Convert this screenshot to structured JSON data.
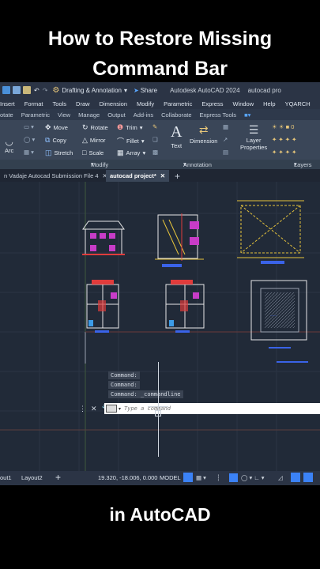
{
  "overlay": {
    "headline_line1": "How to Restore Missing",
    "headline_line2": "Command Bar",
    "footer": "in AutoCAD"
  },
  "titlebar": {
    "workspace": "Drafting & Annotation",
    "share": "Share",
    "app_title": "Autodesk AutoCAD 2024",
    "file_title": "autocad pro"
  },
  "menu": [
    "Insert",
    "Format",
    "Tools",
    "Draw",
    "Dimension",
    "Modify",
    "Parametric",
    "Express",
    "Window",
    "Help",
    "YQARCH"
  ],
  "ribbon_tabs": [
    "otate",
    "Parametric",
    "View",
    "Manage",
    "Output",
    "Add-ins",
    "Collaborate",
    "Express Tools"
  ],
  "ribbon": {
    "arc": "Arc",
    "move": "Move",
    "rotate": "Rotate",
    "trim": "Trim",
    "copy": "Copy",
    "mirror": "Mirror",
    "fillet": "Fillet",
    "stretch": "Stretch",
    "scale": "Scale",
    "array": "Array",
    "text": "Text",
    "dimension": "Dimension",
    "layer_properties_1": "Layer",
    "layer_properties_2": "Properties",
    "modify_panel": "Modify",
    "annotation_panel": "Annotation",
    "layers_panel": "Layers"
  },
  "doc_tabs": {
    "tab1": "n Vadaje Autocad Submission File 4",
    "tab2": "autocad project*"
  },
  "command": {
    "history": [
      "Command:",
      "Command:",
      "Command:  _commandline"
    ],
    "placeholder": "Type a command"
  },
  "status": {
    "layout1": "out1",
    "layout2": "Layout2",
    "coords": "19.320, -18.006, 0.000",
    "model": "MODEL"
  },
  "colors": {
    "canvas": "#212a38",
    "ribbon": "#3a4658",
    "accent_blue": "#3b82f6"
  }
}
